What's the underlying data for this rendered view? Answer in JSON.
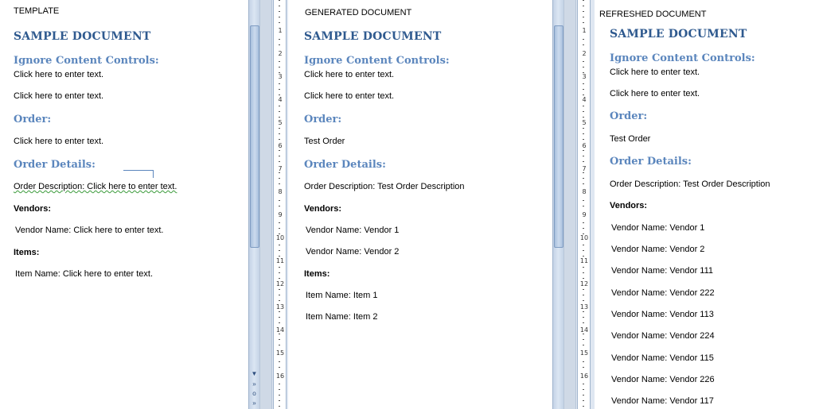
{
  "panels": {
    "template": {
      "label": "TEMPLATE",
      "title": "SAMPLE DOCUMENT",
      "ignore_heading": "Ignore Content Controls:",
      "ignore_line1": "Click here to enter text.",
      "ignore_line2": "Click here to enter text.",
      "order_heading": "Order:",
      "order_value": "Click here to enter text.",
      "details_heading": "Order Details:",
      "order_description": "Order Description: Click here to enter text.",
      "vendors_label": "Vendors:",
      "vendor_name": "Vendor Name: Click here to enter text.",
      "items_label": "Items:",
      "item_name": "Item Name: Click here to enter text."
    },
    "generated": {
      "label": "GENERATED DOCUMENT",
      "title": "SAMPLE DOCUMENT",
      "ignore_heading": "Ignore Content Controls:",
      "ignore_line1": "Click here to enter text.",
      "ignore_line2": "Click here to enter text.",
      "order_heading": "Order:",
      "order_value": "Test Order",
      "details_heading": "Order Details:",
      "order_description": "Order Description: Test Order Description",
      "vendors_label": "Vendors:",
      "vendors": [
        "Vendor Name: Vendor 1",
        "Vendor Name: Vendor 2"
      ],
      "items_label": "Items:",
      "items": [
        "Item Name: Item 1",
        "Item Name: Item 2"
      ]
    },
    "refreshed": {
      "label": "REFRESHED DOCUMENT",
      "title": "SAMPLE DOCUMENT",
      "ignore_heading": "Ignore Content Controls:",
      "ignore_line1": "Click here to enter text.",
      "ignore_line2": "Click here to enter text.",
      "order_heading": "Order:",
      "order_value": "Test Order",
      "details_heading": "Order Details:",
      "order_description": "Order Description: Test Order Description",
      "vendors_label": "Vendors:",
      "vendors": [
        "Vendor Name: Vendor 1",
        "Vendor Name: Vendor 2",
        "Vendor Name: Vendor 111",
        "Vendor Name: Vendor 222",
        "Vendor Name: Vendor 113",
        "Vendor Name: Vendor 224",
        "Vendor Name: Vendor 115",
        "Vendor Name: Vendor 226",
        "Vendor Name: Vendor 117"
      ]
    }
  },
  "ruler_numbers": [
    "1",
    "2",
    "3",
    "4",
    "5",
    "6",
    "7",
    "8",
    "9",
    "10",
    "11",
    "12",
    "13",
    "14",
    "15",
    "16"
  ],
  "icons": {
    "scroll_down": "▼",
    "prev_page": "»",
    "select_browse": "o",
    "next_page": "»"
  },
  "colors": {
    "title": "#2f5a8f",
    "heading": "#5b86bd",
    "spell_check": "#3a9a3a"
  }
}
